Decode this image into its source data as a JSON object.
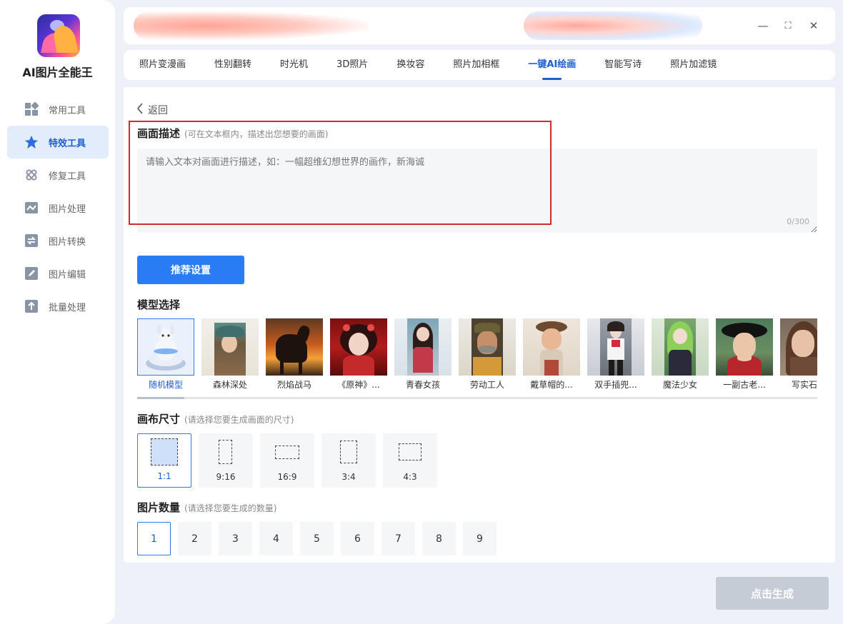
{
  "app": {
    "name": "AI图片全能王"
  },
  "sidebar": {
    "items": [
      {
        "label": "常用工具",
        "icon": "grid-icon",
        "active": false
      },
      {
        "label": "特效工具",
        "icon": "star-icon",
        "active": true
      },
      {
        "label": "修复工具",
        "icon": "bandage-icon",
        "active": false
      },
      {
        "label": "图片处理",
        "icon": "image-wave-icon",
        "active": false
      },
      {
        "label": "图片转换",
        "icon": "convert-icon",
        "active": false
      },
      {
        "label": "图片编辑",
        "icon": "edit-icon",
        "active": false
      },
      {
        "label": "批量处理",
        "icon": "upload-icon",
        "active": false
      }
    ]
  },
  "window": {
    "minimize": "—",
    "maximize": "⛶",
    "close": "✕"
  },
  "tabs": [
    {
      "label": "照片变漫画"
    },
    {
      "label": "性别翻转"
    },
    {
      "label": "时光机"
    },
    {
      "label": "3D照片"
    },
    {
      "label": "换妆容"
    },
    {
      "label": "照片加相框"
    },
    {
      "label": "一键AI绘画",
      "active": true
    },
    {
      "label": "智能写诗"
    },
    {
      "label": "照片加滤镜"
    }
  ],
  "main": {
    "back_label": "返回",
    "description": {
      "title": "画面描述",
      "hint": "(可在文本框内，描述出您想要的画面)",
      "placeholder": "请输入文本对画面进行描述，如：一幅超维幻想世界的画作，新海诚",
      "value": "",
      "counter": "0/300"
    },
    "recommend_button": "推荐设置",
    "model": {
      "title": "模型选择",
      "items": [
        {
          "label": "随机模型",
          "selected": true
        },
        {
          "label": "森林深处"
        },
        {
          "label": "烈焰战马"
        },
        {
          "label": "《原神》..."
        },
        {
          "label": "青春女孩"
        },
        {
          "label": "劳动工人"
        },
        {
          "label": "戴草帽的..."
        },
        {
          "label": "双手插兜..."
        },
        {
          "label": "魔法少女"
        },
        {
          "label": "一副古老..."
        },
        {
          "label": "写实石板"
        }
      ]
    },
    "canvas": {
      "title": "画布尺寸",
      "hint": "(请选择您要生成画面的尺寸)",
      "ratios": [
        {
          "label": "1:1",
          "selected": true
        },
        {
          "label": "9:16"
        },
        {
          "label": "16:9"
        },
        {
          "label": "3:4"
        },
        {
          "label": "4:3"
        }
      ]
    },
    "count": {
      "title": "图片数量",
      "hint": "(请选择您要生成的数量)",
      "options": [
        "1",
        "2",
        "3",
        "4",
        "5",
        "6",
        "7",
        "8",
        "9"
      ],
      "selected": "1"
    }
  },
  "generate_button": "点击生成",
  "colors": {
    "accent": "#2a7cf4",
    "highlight_box": "#d42a2a",
    "disabled": "#c5ccd6"
  }
}
